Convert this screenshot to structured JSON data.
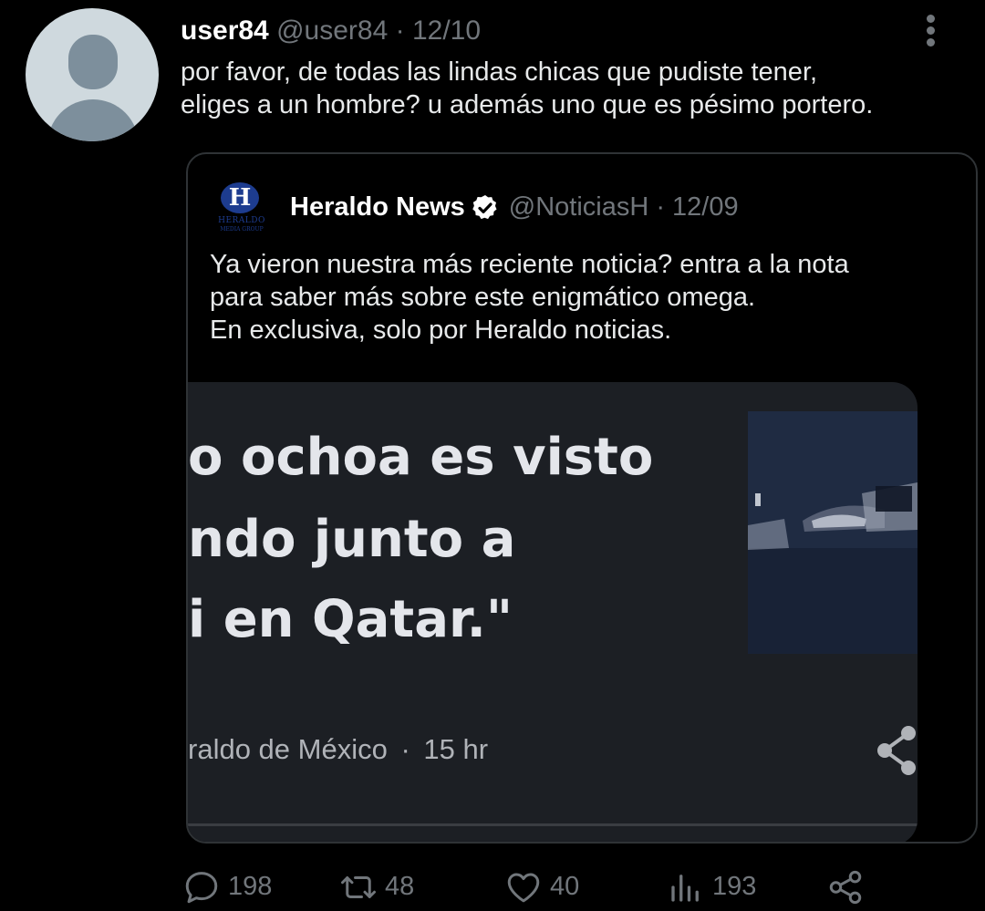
{
  "tweet": {
    "display_name": "user84",
    "handle": "@user84",
    "date": "12/10",
    "separator": "·",
    "text_line1": "por favor, de todas las lindas chicas que pudiste tener,",
    "text_line2": "eliges a un hombre? u además uno que es pésimo portero."
  },
  "quoted_tweet": {
    "avatar_logo_letter": "H",
    "avatar_logo_text": "HERALDO",
    "avatar_logo_subtext": "MEDIA GROUP",
    "display_name": "Heraldo News",
    "verified": true,
    "handle": "@NoticiasH",
    "date": "12/09",
    "separator": "·",
    "text_line1": "Ya vieron nuestra más reciente noticia? entra a la nota",
    "text_line2": "para saber más sobre este enigmático omega.",
    "text_line3": "En exclusiva, solo por Heraldo noticias.",
    "media": {
      "headline_line1": "o ochoa es visto",
      "headline_line2": "ndo junto a",
      "headline_line3": "i en Qatar.\"",
      "source": "raldo de México",
      "separator": "·",
      "age": "15 hr"
    }
  },
  "actions": {
    "replies": "198",
    "retweets": "48",
    "likes": "40",
    "views": "193"
  },
  "icons": [
    "more-icon",
    "verified-icon",
    "share-icon",
    "reply-icon",
    "retweet-icon",
    "like-icon",
    "views-icon",
    "share-icon"
  ],
  "colors": {
    "background": "#000000",
    "primary_text": "#e7e9ea",
    "secondary_text": "#71767b",
    "border": "#2f3336",
    "media_bg": "#1c1f24",
    "logo_blue": "#1d3c8f"
  }
}
